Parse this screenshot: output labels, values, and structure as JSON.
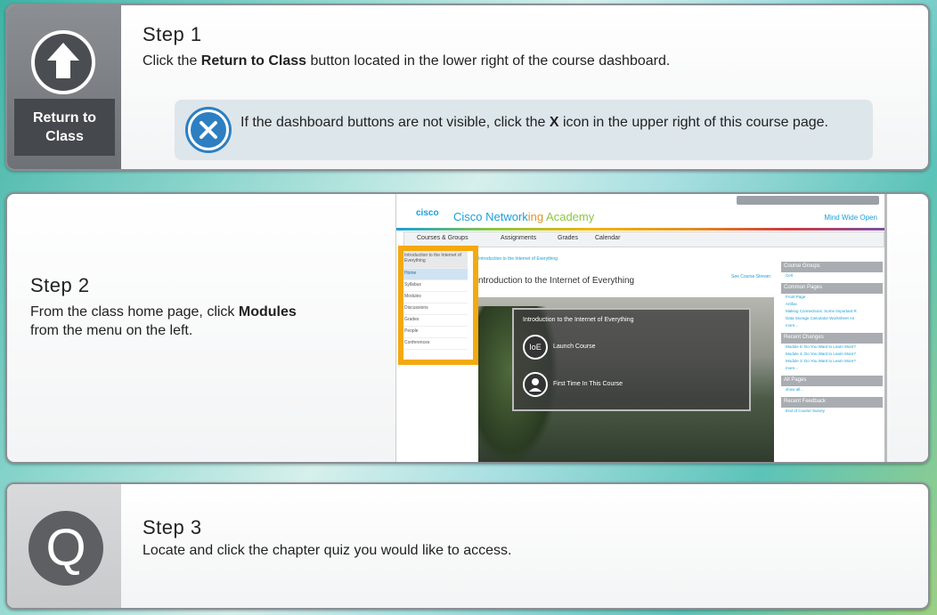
{
  "step1": {
    "title": "Step 1",
    "text_pre": "Click the ",
    "text_bold": "Return to Class",
    "text_post": " button located in the lower right of the course dashboard.",
    "button_label_line1": "Return to",
    "button_label_line2": "Class",
    "note_pre": "If the dashboard buttons are not visible, click the ",
    "note_bold": "X",
    "note_post": " icon in the upper right of this course page."
  },
  "step2": {
    "title": "Step 2",
    "text_pre": "From the class home page, click ",
    "text_bold": "Modules",
    "text_post": " from the menu on the left.",
    "shot": {
      "logo": "cisco",
      "site_title_a": "Cisco Network",
      "site_title_b": "ing",
      "site_title_c": " Academy",
      "tagline": "Mind Wide Open",
      "nav": [
        "Courses & Groups",
        "Assignments",
        "Grades",
        "Calendar"
      ],
      "menu_header": "Introduction to the Internet of Everything",
      "menu": [
        "Home",
        "Syllabus",
        "Modules",
        "Discussions",
        "Grades",
        "People",
        "Conferences"
      ],
      "breadcrumb": "Introduction to the Internet of Everything",
      "page_heading": "ntroduction to the Internet of Everything",
      "see_stream": "See Course Stream",
      "hero_title": "Introduction to the Internet of Everything",
      "hero_launch_icon": "IoE",
      "hero_launch": "Launch Course",
      "hero_first": "First Time In This Course",
      "right": {
        "course_groups": "Course Groups",
        "cell": "Cell",
        "common_pages": "Common Pages",
        "pages": [
          "Front Page",
          "Artifax",
          "Making Connections: Some Important R",
          "Data Storage Calculator Worksheet An",
          "more..."
        ],
        "recent_changes": "Recent Changes",
        "changes": [
          "Module 5: Do You Want to Learn More?",
          "Module 4: Do You Want to Learn More?",
          "Module 3: Do You Want to Learn More?",
          "more..."
        ],
        "all_pages": "All Pages",
        "all_more": "show all...",
        "recent_feedback": "Recent Feedback",
        "feedback": [
          "End of Course Survey"
        ]
      }
    }
  },
  "step3": {
    "title": "Step 3",
    "text": "Locate and click the chapter quiz you would like to access.",
    "icon_letter": "Q"
  },
  "colors": {
    "accent": "#2d7fc1",
    "highlight": "#f4a90f",
    "cisco": "#1ba0d7"
  }
}
